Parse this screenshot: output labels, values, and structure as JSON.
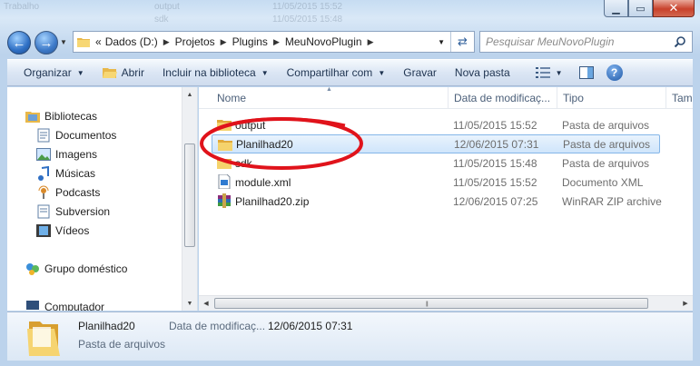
{
  "ghost_text": [
    "Trabalho",
    "output",
    "11/05/2015 15:52",
    "sdk",
    "11/05/2015 15:48"
  ],
  "window": {
    "minimize_glyph": "▁",
    "maximize_glyph": "▭",
    "close_glyph": "✕"
  },
  "nav": {
    "back_icon": "arrow-left",
    "forward_icon": "arrow-right",
    "breadcrumb_prefix": "«",
    "breadcrumb": [
      "Dados (D:)",
      "Projetos",
      "Plugins",
      "MeuNovoPlugin"
    ],
    "search_placeholder": "Pesquisar MeuNovoPlugin"
  },
  "toolbar": {
    "organize": "Organizar",
    "open": "Abrir",
    "include_library": "Incluir na biblioteca",
    "share": "Compartilhar com",
    "burn": "Gravar",
    "new_folder": "Nova pasta",
    "help": "?"
  },
  "sidebar": {
    "libraries": "Bibliotecas",
    "items": [
      "Documentos",
      "Imagens",
      "Músicas",
      "Podcasts",
      "Subversion",
      "Vídeos"
    ],
    "homegroup": "Grupo doméstico",
    "computer": "Computador"
  },
  "columns": {
    "name": "Nome",
    "date": "Data de modificaç...",
    "type": "Tipo",
    "size": "Tam"
  },
  "files": [
    {
      "name": "output",
      "date": "11/05/2015 15:52",
      "type": "Pasta de arquivos",
      "icon": "folder-icon",
      "selected": false
    },
    {
      "name": "Planilhad20",
      "date": "12/06/2015 07:31",
      "type": "Pasta de arquivos",
      "icon": "folder-icon",
      "selected": true
    },
    {
      "name": "sdk",
      "date": "11/05/2015 15:48",
      "type": "Pasta de arquivos",
      "icon": "folder-icon",
      "selected": false
    },
    {
      "name": "module.xml",
      "date": "11/05/2015 15:52",
      "type": "Documento XML",
      "icon": "xml-file-icon",
      "selected": false
    },
    {
      "name": "Planilhad20.zip",
      "date": "12/06/2015 07:25",
      "type": "WinRAR ZIP archive",
      "icon": "winrar-archive-icon",
      "selected": false
    }
  ],
  "details": {
    "name": "Planilhad20",
    "type": "Pasta de arquivos",
    "date_label": "Data de modificaç...",
    "date_value": "12/06/2015 07:31"
  },
  "colors": {
    "selection_border": "#84b6e8",
    "annotation": "#e0131b",
    "folder": "#f2c94c"
  }
}
